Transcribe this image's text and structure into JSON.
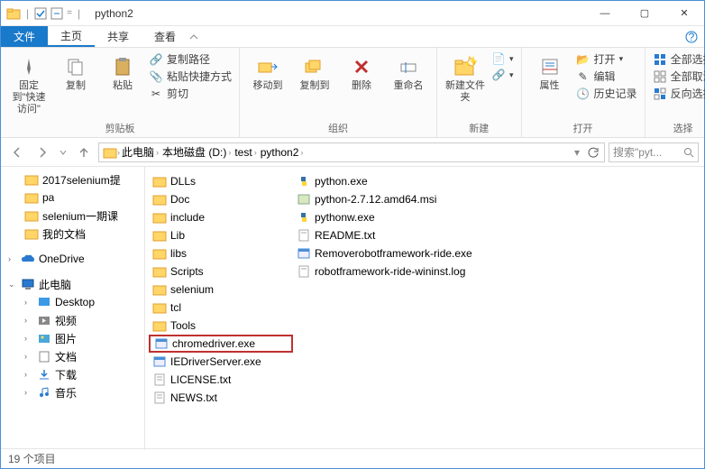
{
  "window": {
    "title": "python2"
  },
  "win_controls": {
    "min": "—",
    "max": "▢",
    "close": "✕"
  },
  "tabs": {
    "file": "文件",
    "home": "主页",
    "share": "共享",
    "view": "查看"
  },
  "ribbon": {
    "clipboard": {
      "label": "剪贴板",
      "pin": "固定到\"快速访问\"",
      "copy": "复制",
      "paste": "粘贴",
      "copypath": "复制路径",
      "pasteshortcut": "粘贴快捷方式",
      "cut": "剪切"
    },
    "organize": {
      "label": "组织",
      "moveto": "移动到",
      "copyto": "复制到",
      "delete": "删除",
      "rename": "重命名"
    },
    "new": {
      "label": "新建",
      "newfolder": "新建文件夹"
    },
    "open": {
      "label": "打开",
      "properties": "属性",
      "open": "打开",
      "edit": "编辑",
      "history": "历史记录"
    },
    "select": {
      "label": "选择",
      "selectall": "全部选择",
      "selectnone": "全部取消",
      "invert": "反向选择"
    }
  },
  "breadcrumb": {
    "thispc": "此电脑",
    "drive": "本地磁盘 (D:)",
    "folder1": "test",
    "folder2": "python2"
  },
  "search": {
    "placeholder": "搜索\"pyt..."
  },
  "tree": {
    "i0": "2017selenium提",
    "i1": "pa",
    "i2": "selenium一期课",
    "i3": "我的文档",
    "i4": "OneDrive",
    "i5": "此电脑",
    "i6": "Desktop",
    "i7": "视频",
    "i8": "图片",
    "i9": "文档",
    "i10": "下载",
    "i11": "音乐"
  },
  "files": {
    "col1": {
      "f0": "DLLs",
      "f1": "Doc",
      "f2": "include",
      "f3": "Lib",
      "f4": "libs",
      "f5": "Scripts",
      "f6": "selenium",
      "f7": "tcl",
      "f8": "Tools",
      "f9": "chromedriver.exe",
      "f10": "IEDriverServer.exe",
      "f11": "LICENSE.txt",
      "f12": "NEWS.txt"
    },
    "col2": {
      "f0": "python.exe",
      "f1": "python-2.7.12.amd64.msi",
      "f2": "pythonw.exe",
      "f3": "README.txt",
      "f4": "Removerobotframework-ride.exe",
      "f5": "robotframework-ride-wininst.log"
    }
  },
  "status": {
    "count": "19 个项目"
  }
}
